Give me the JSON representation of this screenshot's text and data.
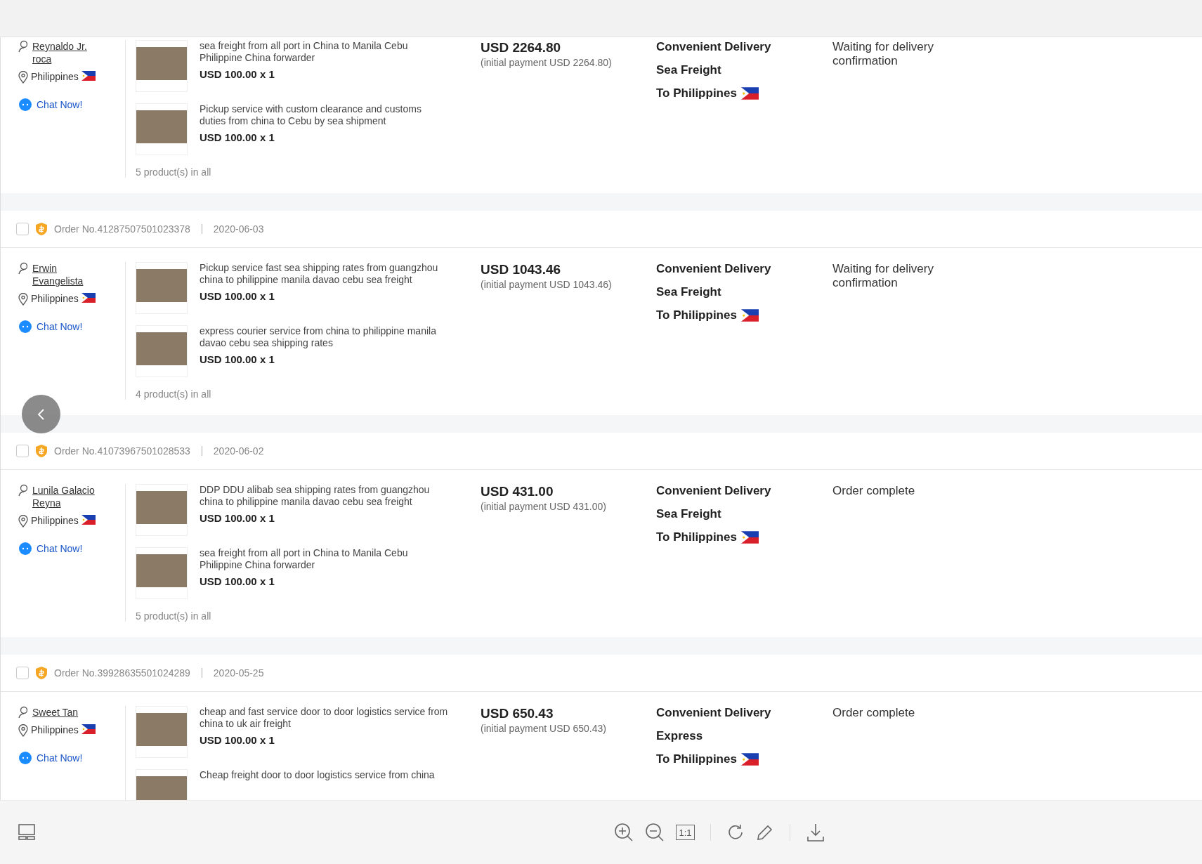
{
  "orders": [
    {
      "buyer": {
        "name": "Reynaldo Jr. roca",
        "country": "Philippines"
      },
      "chat": "Chat Now!",
      "products": [
        {
          "title": "sea freight from all port in China to Manila Cebu Philippine China forwarder",
          "price": "USD 100.00 x 1"
        },
        {
          "title": "Pickup service with custom clearance and customs duties from china to Cebu by sea shipment",
          "price": "USD 100.00 x 1"
        }
      ],
      "count": "5 product(s) in all",
      "total": "USD 2264.80",
      "initial": "(initial payment USD 2264.80)",
      "delivery": [
        "Convenient Delivery",
        "Sea Freight",
        "To Philippines"
      ],
      "status": "Waiting for delivery confirmation"
    },
    {
      "order_no": "Order No.41287507501023378",
      "date": "2020-06-03",
      "checked": false,
      "buyer": {
        "name": "Erwin Evangelista",
        "country": "Philippines"
      },
      "chat": "Chat Now!",
      "products": [
        {
          "title": "Pickup service fast sea shipping rates from guangzhou china to philippine manila davao cebu sea freight",
          "price": "USD 100.00 x 1"
        },
        {
          "title": "express courier service from china to philippine manila davao cebu sea shipping rates",
          "price": "USD 100.00 x 1"
        }
      ],
      "count": "4 product(s) in all",
      "total": "USD 1043.46",
      "initial": "(initial payment USD 1043.46)",
      "delivery": [
        "Convenient Delivery",
        "Sea Freight",
        "To Philippines"
      ],
      "status": "Waiting for delivery confirmation"
    },
    {
      "order_no": "Order No.41073967501028533",
      "date": "2020-06-02",
      "checked": false,
      "buyer": {
        "name": "Lunila Galacio Reyna",
        "country": "Philippines"
      },
      "chat": "Chat Now!",
      "products": [
        {
          "title": "DDP DDU alibab sea shipping rates from guangzhou china to philippine manila davao cebu sea freight",
          "price": "USD 100.00 x 1"
        },
        {
          "title": "sea freight from all port in China to Manila Cebu Philippine China forwarder",
          "price": "USD 100.00 x 1"
        }
      ],
      "count": "5 product(s) in all",
      "total": "USD 431.00",
      "initial": "(initial payment USD 431.00)",
      "delivery": [
        "Convenient Delivery",
        "Sea Freight",
        "To Philippines"
      ],
      "status": "Order complete"
    },
    {
      "order_no": "Order No.39928635501024289",
      "date": "2020-05-25",
      "checked": false,
      "buyer": {
        "name": "Sweet Tan",
        "country": "Philippines"
      },
      "chat": "Chat Now!",
      "products": [
        {
          "title": "cheap and fast service door to door logistics service from china to uk air freight",
          "price": "USD 100.00 x 1"
        },
        {
          "title": "Cheap freight door to door logistics service from china"
        }
      ],
      "total": "USD 650.43",
      "initial": "(initial payment USD 650.43)",
      "delivery": [
        "Convenient Delivery",
        "Express",
        "To Philippines"
      ],
      "status": "Order complete"
    }
  ],
  "toolbar": {
    "actual_size": "1:1"
  }
}
